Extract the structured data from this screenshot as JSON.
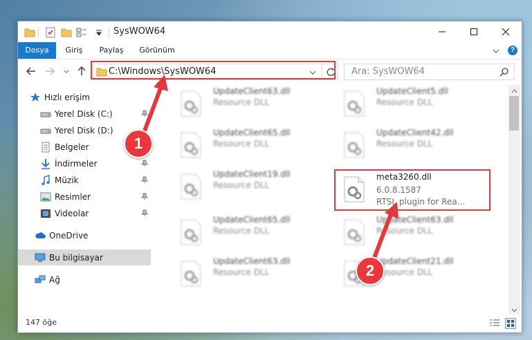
{
  "window": {
    "title": "SysWOW64"
  },
  "ribbon": {
    "tabs": [
      "Dosya",
      "Giriş",
      "Paylaş",
      "Görünüm"
    ]
  },
  "address": {
    "path": "C:\\Windows\\SysWOW64"
  },
  "search": {
    "placeholder": "Ara: SysWOW64"
  },
  "sidebar": {
    "items": [
      {
        "label": "Hızlı erişim",
        "icon": "star-icon"
      },
      {
        "label": "Yerel Disk (C:)",
        "icon": "drive-icon"
      },
      {
        "label": "Yerel Disk (D:)",
        "icon": "drive-icon"
      },
      {
        "label": "Belgeler",
        "icon": "documents-icon"
      },
      {
        "label": "İndirmeler",
        "icon": "download-icon"
      },
      {
        "label": "Müzik",
        "icon": "music-icon"
      },
      {
        "label": "Resimler",
        "icon": "pictures-icon"
      },
      {
        "label": "Videolar",
        "icon": "videos-icon"
      },
      {
        "label": "OneDrive",
        "icon": "cloud-icon"
      },
      {
        "label": "Bu bilgisayar",
        "icon": "computer-icon"
      },
      {
        "label": "Ağ",
        "icon": "network-icon"
      }
    ]
  },
  "files": [
    {
      "name": "UpdateClient63.dll",
      "type": "Resource DLL"
    },
    {
      "name": "UpdateClient5.dll",
      "type": "Resource DLL"
    },
    {
      "name": "UpdateClient65.dll",
      "type": "Resource DLL"
    },
    {
      "name": "UpdateClient42.dll",
      "type": "Resource DLL"
    },
    {
      "name": "UpdateClient19.dll",
      "type": "Resource DLL"
    },
    {
      "name": "meta3260.dll",
      "version": "6.0.8.1587",
      "description": "RTSL plugin for Rea..."
    },
    {
      "name": "UpdateClient65.dll",
      "type": "Resource DLL"
    },
    {
      "name": "UpdateClient63.dll",
      "type": "Resource DLL"
    },
    {
      "name": "UpdateClient63.dll",
      "type": "Resource DLL"
    },
    {
      "name": "UpdateClient21.dll",
      "type": "Resource DLL"
    }
  ],
  "status": {
    "count": "147 öğe"
  },
  "annotations": {
    "callout1": "1",
    "callout2": "2",
    "color": "#e0393e"
  },
  "colors": {
    "accent": "#1979ca"
  }
}
